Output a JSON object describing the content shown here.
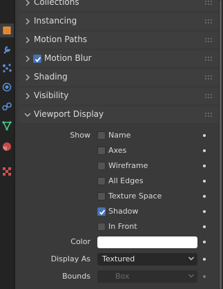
{
  "colors": {
    "background": "#303030",
    "panel_header": "#3e3e3e",
    "checkbox_on": "#4772b3",
    "color_swatch": "#ffffff"
  },
  "tabs": [
    {
      "name": "object-tab",
      "icon": "object-square-icon",
      "active": true
    },
    {
      "name": "modifiers-tab",
      "icon": "wrench-icon"
    },
    {
      "name": "particles-tab",
      "icon": "particles-icon"
    },
    {
      "name": "physics-tab",
      "icon": "physics-orbit-icon"
    },
    {
      "name": "constraints-tab",
      "icon": "constraint-icon"
    },
    {
      "name": "data-tab",
      "icon": "vertex-data-icon"
    },
    {
      "name": "material-tab",
      "icon": "material-sphere-icon"
    },
    {
      "name": "texture-tab",
      "icon": "checker-texture-icon"
    }
  ],
  "panels": {
    "collections": "Collections",
    "instancing": "Instancing",
    "motion_paths": "Motion Paths",
    "motion_blur": "Motion Blur",
    "shading": "Shading",
    "visibility": "Visibility",
    "viewport_display": "Viewport Display"
  },
  "motion_blur_enabled": true,
  "viewport_display": {
    "show_label": "Show",
    "show_options": [
      {
        "label": "Name",
        "checked": false
      },
      {
        "label": "Axes",
        "checked": false
      },
      {
        "label": "Wireframe",
        "checked": false
      },
      {
        "label": "All Edges",
        "checked": false
      },
      {
        "label": "Texture Space",
        "checked": false
      },
      {
        "label": "Shadow",
        "checked": true
      },
      {
        "label": "In Front",
        "checked": false
      }
    ],
    "color_label": "Color",
    "color_value": "#ffffff",
    "display_as_label": "Display As",
    "display_as_value": "Textured",
    "bounds_label": "Bounds",
    "bounds_checked": false,
    "bounds_value": "Box"
  }
}
